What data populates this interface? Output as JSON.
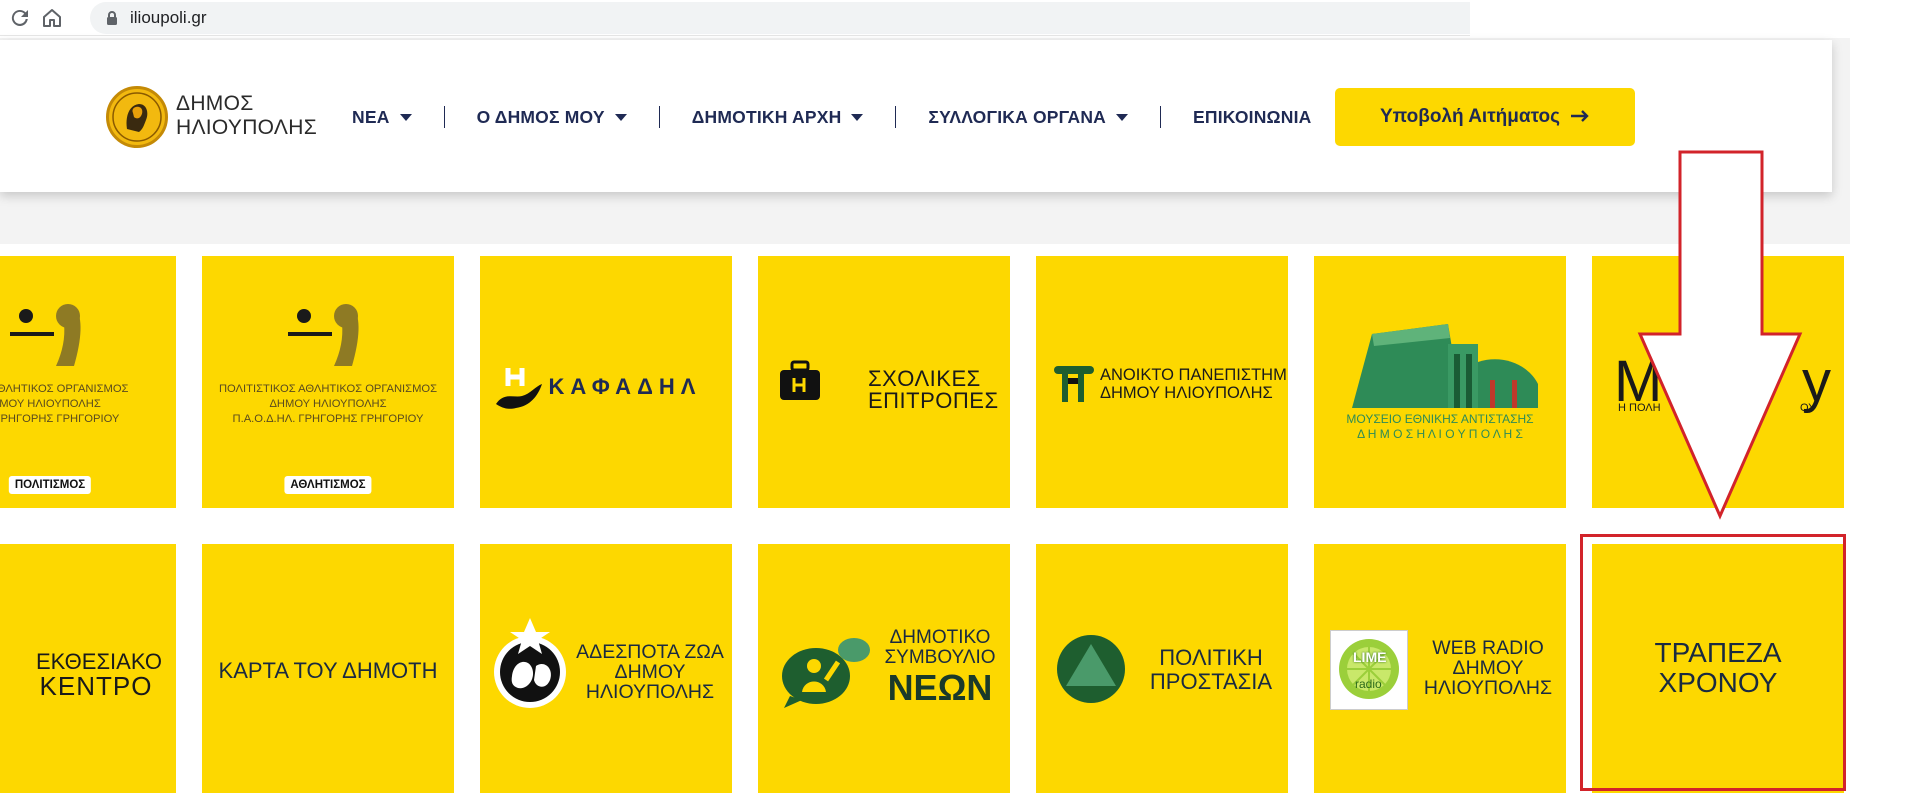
{
  "browser": {
    "url": "ilioupoli.gr"
  },
  "header": {
    "logo_line1": "ΔΗΜΟΣ",
    "logo_line2": "ΗΛΙΟΥΠΟΛΗΣ",
    "nav": [
      {
        "label": "ΝΕΑ",
        "dropdown": true
      },
      {
        "label": "Ο ΔΗΜΟΣ ΜΟΥ",
        "dropdown": true
      },
      {
        "label": "ΔΗΜΟΤΙΚΗ ΑΡΧΗ",
        "dropdown": true
      },
      {
        "label": "ΣΥΛΛΟΓΙΚΑ ΟΡΓΑΝΑ",
        "dropdown": true
      },
      {
        "label": "ΕΠΙΚΟΙΝΩΝΙΑ",
        "dropdown": false
      }
    ],
    "cta_label": "Υποβολή Αιτήματος"
  },
  "tiles_row1": [
    {
      "l1": "ΟΣ ΑΘΛΗΤΙΚΟΣ ΟΡΓΑΝΙΣΜΟΣ",
      "l2": "ΜΟΥ ΗΛΙΟΥΠΟΛΗΣ",
      "l3": "Λ. ΓΡΗΓΟΡΗΣ ΓΡΗΓΟΡΙΟΥ",
      "tag": "ΠΟΛΙΤΙΣΜΟΣ"
    },
    {
      "l1": "ΠΟΛΙΤΙΣΤΙΚΟΣ ΑΘΛΗΤΙΚΟΣ ΟΡΓΑΝΙΣΜΟΣ",
      "l2": "ΔΗΜΟΥ ΗΛΙΟΥΠΟΛΗΣ",
      "l3": "Π.Α.Ο.Δ.ΗΛ. ΓΡΗΓΟΡΗΣ ΓΡΗΓΟΡΙΟΥ",
      "tag": "ΑΘΛΗΤΙΣΜΟΣ"
    },
    {
      "label": "ΚΑΦΑΔΗΛ"
    },
    {
      "l1": "ΣΧΟΛΙΚΕΣ",
      "l2": "ΕΠΙΤΡΟΠΕΣ"
    },
    {
      "l1": "ΑΝΟΙΚΤΟ ΠΑΝΕΠΙΣΤΗΜΙΟ",
      "l2": "ΔΗΜΟΥ ΗΛΙΟΥΠΟΛΗΣ"
    },
    {
      "l1": "ΜΟΥΣΕΙΟ ΕΘΝΙΚΗΣ ΑΝΤΙΣΤΑΣΗΣ",
      "l2": "Δ Η Μ Ο Σ   Η Λ Ι Ο Υ Π Ο Λ Η Σ"
    },
    {
      "big": "M",
      "big2": "y",
      "small": "Η ΠΟΛΗ",
      "small2": "ΟΥ"
    }
  ],
  "tiles_row2": [
    {
      "l1": "ΕΚΘΕΣΙΑΚΟ",
      "l2": "ΚΕΝΤΡΟ"
    },
    {
      "label": "ΚΑΡΤΑ ΤΟΥ ΔΗΜΟΤΗ"
    },
    {
      "l1": "ΑΔΕΣΠΟΤΑ ΖΩΑ",
      "l2": "ΔΗΜΟΥ",
      "l3": "ΗΛΙΟΥΠΟΛΗΣ"
    },
    {
      "l1": "ΔΗΜΟΤΙΚΟ",
      "l2": "ΣΥΜΒΟΥΛΙΟ",
      "l3": "ΝΕΩΝ"
    },
    {
      "l1": "ΠΟΛΙΤΙΚΗ",
      "l2": "ΠΡΟΣΤΑΣΙΑ"
    },
    {
      "l1": "WEB RADIO",
      "l2": "ΔΗΜΟΥ",
      "l3": "ΗΛΙΟΥΠΟΛΗΣ",
      "radio_top": "LIME",
      "radio_bottom": "radio"
    },
    {
      "l1": "ΤΡΑΠΕΖΑ",
      "l2": "ΧΡΟΝΟΥ"
    }
  ],
  "colors": {
    "tile": "#fdd800",
    "navy": "#1f2a54",
    "annotation_red": "#d2232a"
  }
}
